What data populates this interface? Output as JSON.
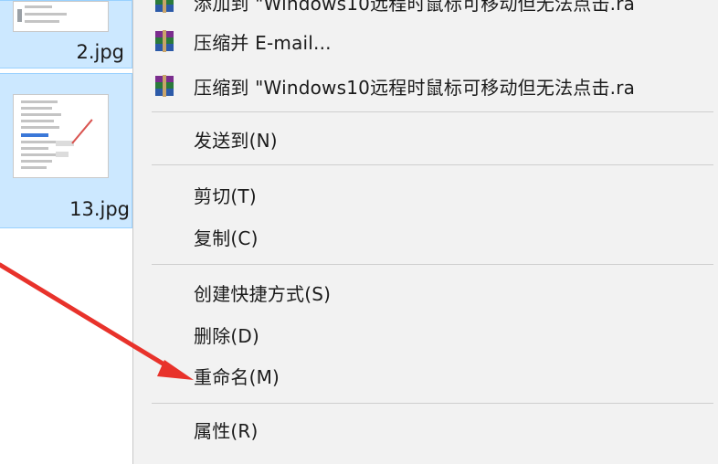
{
  "files": [
    {
      "name": "2.jpg"
    },
    {
      "name": "13.jpg"
    }
  ],
  "context_menu": {
    "items": [
      {
        "label": "添加到 \"Windows10远程时鼠标可移动但无法点击.ra",
        "icon": "winrar-icon"
      },
      {
        "label": "压缩并 E-mail...",
        "icon": "winrar-icon"
      },
      {
        "label": "压缩到 \"Windows10远程时鼠标可移动但无法点击.ra",
        "icon": "winrar-icon"
      },
      {
        "label": "发送到(N)"
      },
      {
        "label": "剪切(T)"
      },
      {
        "label": "复制(C)"
      },
      {
        "label": "创建快捷方式(S)"
      },
      {
        "label": "删除(D)"
      },
      {
        "label": "重命名(M)"
      },
      {
        "label": "属性(R)"
      }
    ]
  },
  "annotation": {
    "type": "arrow",
    "color": "#e8322b",
    "points_to": "重命名(M)"
  },
  "colors": {
    "selection": "#cce8ff",
    "menu_bg": "#f2f2f2",
    "arrow": "#e8322b"
  }
}
